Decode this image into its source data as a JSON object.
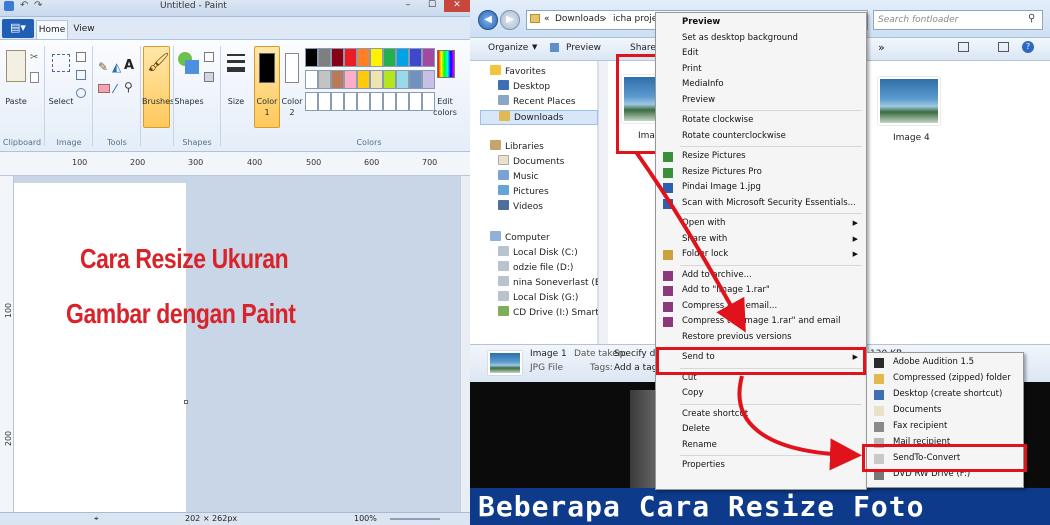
{
  "paint": {
    "title": "Untitled - Paint",
    "tabs": [
      "Home",
      "View"
    ],
    "groups": {
      "clipboard": "Clipboard",
      "image": "Image",
      "tools": "Tools",
      "shapes": "Shapes",
      "colors": "Colors"
    },
    "buttons": {
      "paste": "Paste",
      "select": "Select",
      "brushes": "Brushes",
      "shapes": "Shapes",
      "size": "Size",
      "color1": "Color\n1",
      "color1_a": "Color",
      "color1_b": "1",
      "color2_a": "Color",
      "color2_b": "2",
      "edit_colors_a": "Edit",
      "edit_colors_b": "colors"
    },
    "ruler_h": [
      "100",
      "200",
      "300",
      "400",
      "500",
      "600",
      "700"
    ],
    "ruler_v": [
      "100",
      "200"
    ],
    "overlay_line1": "Cara Resize Ukuran",
    "overlay_line2": "Gambar dengan Paint",
    "status": {
      "dims": "202 × 262px",
      "zoom": "100%"
    },
    "palette": [
      "#000000",
      "#7f7f7f",
      "#880015",
      "#ed1c24",
      "#ff7f27",
      "#fff200",
      "#22b14c",
      "#00a2e8",
      "#3f48cc",
      "#a349a4",
      "#ffffff",
      "#c3c3c3",
      "#b97a57",
      "#ffaec9",
      "#ffc90e",
      "#efe4b0",
      "#b5e61d",
      "#99d9ea",
      "#7092be",
      "#c8bfe7"
    ]
  },
  "explorer": {
    "path": [
      "«",
      "Downloads",
      "›",
      "icha project"
    ],
    "search_placeholder": "Search fontloader",
    "toolbar": {
      "organize": "Organize",
      "preview": "Preview",
      "share": "Share w"
    },
    "nav": {
      "favorites": "Favorites",
      "desktop": "Desktop",
      "recent": "Recent Places",
      "downloads": "Downloads",
      "libraries": "Libraries",
      "documents": "Documents",
      "music": "Music",
      "pictures": "Pictures",
      "videos": "Videos",
      "computer": "Computer",
      "c": "Local Disk (C:)",
      "d": "odzie file (D:)",
      "e": "nina Soneverlast  (E:)",
      "g": "Local Disk (G:)",
      "i": "CD Drive (I:) Smartfren"
    },
    "files": [
      {
        "name": "Image 1"
      },
      {
        "name": "Image 4"
      }
    ],
    "details": {
      "name": "Image 1",
      "type": "JPG File",
      "date_label": "Date taken:",
      "date_value": "Specify date",
      "tags_label": "Tags:",
      "tags_value": "Add a tag",
      "size": "120 KB"
    },
    "banner": "Beberapa Cara Resize Foto"
  },
  "context_menu": {
    "items": [
      "Preview",
      "Set as desktop background",
      "Edit",
      "Print",
      "MediaInfo",
      "Preview",
      "Rotate clockwise",
      "Rotate counterclockwise",
      "Resize Pictures",
      "Resize Pictures Pro",
      "Pindai Image 1.jpg",
      "Scan with Microsoft Security Essentials...",
      "Open with",
      "Share with",
      "Folder lock",
      "Add to archive...",
      "Add to \"Image 1.rar\"",
      "Compress and email...",
      "Compress to \"Image 1.rar\" and email",
      "Restore previous versions",
      "Send to",
      "Cut",
      "Copy",
      "Create shortcut",
      "Delete",
      "Rename",
      "Properties"
    ]
  },
  "send_to": {
    "items": [
      "Adobe Audition 1.5",
      "Compressed (zipped) folder",
      "Desktop (create shortcut)",
      "Documents",
      "Fax recipient",
      "Mail recipient",
      "SendTo-Convert",
      "DVD RW Drive (F:)"
    ]
  },
  "colors": {
    "accent_red": "#e0121c",
    "banner_blue": "#0d3a8a",
    "paint_blue": "#1f5fb6"
  }
}
